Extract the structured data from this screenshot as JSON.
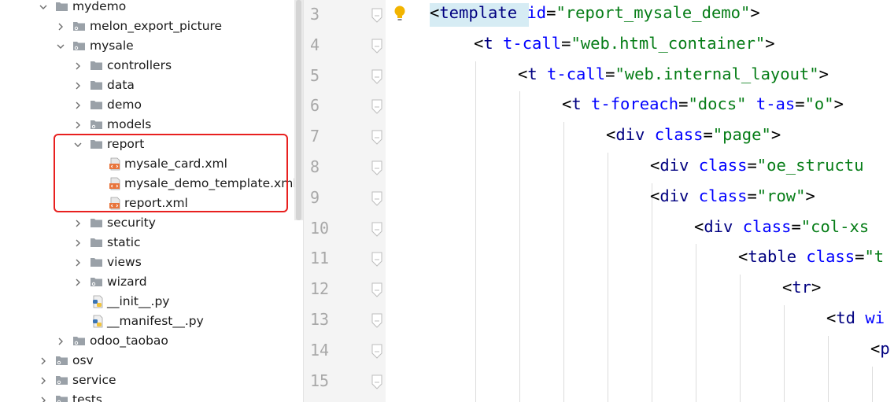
{
  "tree": {
    "items": [
      {
        "label": "mydemo",
        "kind": "folder",
        "expanded": true
      },
      {
        "label": "melon_export_picture",
        "kind": "module",
        "expanded": false
      },
      {
        "label": "mysale",
        "kind": "module",
        "expanded": true
      },
      {
        "label": "controllers",
        "kind": "folder",
        "expanded": false
      },
      {
        "label": "data",
        "kind": "folder",
        "expanded": false
      },
      {
        "label": "demo",
        "kind": "folder",
        "expanded": false
      },
      {
        "label": "models",
        "kind": "module",
        "expanded": false
      },
      {
        "label": "report",
        "kind": "folder",
        "expanded": true
      },
      {
        "label": "mysale_card.xml",
        "kind": "xml"
      },
      {
        "label": "mysale_demo_template.xml",
        "kind": "xml"
      },
      {
        "label": "report.xml",
        "kind": "xml"
      },
      {
        "label": "security",
        "kind": "folder",
        "expanded": false
      },
      {
        "label": "static",
        "kind": "folder",
        "expanded": false
      },
      {
        "label": "views",
        "kind": "folder",
        "expanded": false
      },
      {
        "label": "wizard",
        "kind": "module",
        "expanded": false
      },
      {
        "label": "__init__.py",
        "kind": "python"
      },
      {
        "label": "__manifest__.py",
        "kind": "python"
      },
      {
        "label": "odoo_taobao",
        "kind": "module",
        "expanded": false
      },
      {
        "label": "osv",
        "kind": "module",
        "expanded": false
      },
      {
        "label": "service",
        "kind": "module",
        "expanded": false
      },
      {
        "label": "tests",
        "kind": "module",
        "expanded": false
      }
    ]
  },
  "editor": {
    "line_numbers": [
      "3",
      "4",
      "5",
      "6",
      "7",
      "8",
      "9",
      "10",
      "11",
      "12",
      "13",
      "14",
      "15"
    ],
    "lines": [
      {
        "tokens": [
          [
            "punc",
            "<"
          ],
          [
            "tag",
            "template"
          ],
          [
            "punc",
            " "
          ],
          [
            "attr",
            "id"
          ],
          [
            "punc",
            "="
          ],
          [
            "str",
            "\"report_mysale_demo\""
          ],
          [
            "punc",
            ">"
          ]
        ]
      },
      {
        "tokens": [
          [
            "punc",
            "<"
          ],
          [
            "tag",
            "t"
          ],
          [
            "punc",
            " "
          ],
          [
            "attr",
            "t-call"
          ],
          [
            "punc",
            "="
          ],
          [
            "str",
            "\"web.html_container\""
          ],
          [
            "punc",
            ">"
          ]
        ]
      },
      {
        "tokens": [
          [
            "punc",
            "<"
          ],
          [
            "tag",
            "t"
          ],
          [
            "punc",
            " "
          ],
          [
            "attr",
            "t-call"
          ],
          [
            "punc",
            "="
          ],
          [
            "str",
            "\"web.internal_layout\""
          ],
          [
            "punc",
            ">"
          ]
        ]
      },
      {
        "tokens": [
          [
            "punc",
            "<"
          ],
          [
            "tag",
            "t"
          ],
          [
            "punc",
            " "
          ],
          [
            "attr",
            "t-foreach"
          ],
          [
            "punc",
            "="
          ],
          [
            "str",
            "\"docs\""
          ],
          [
            "punc",
            " "
          ],
          [
            "attr",
            "t-as"
          ],
          [
            "punc",
            "="
          ],
          [
            "str",
            "\"o\""
          ],
          [
            "punc",
            ">"
          ]
        ]
      },
      {
        "tokens": [
          [
            "punc",
            "<"
          ],
          [
            "tag",
            "div"
          ],
          [
            "punc",
            " "
          ],
          [
            "attr",
            "class"
          ],
          [
            "punc",
            "="
          ],
          [
            "str",
            "\"page\""
          ],
          [
            "punc",
            ">"
          ]
        ]
      },
      {
        "tokens": [
          [
            "punc",
            "<"
          ],
          [
            "tag",
            "div"
          ],
          [
            "punc",
            " "
          ],
          [
            "attr",
            "class"
          ],
          [
            "punc",
            "="
          ],
          [
            "str",
            "\"oe_structu"
          ]
        ]
      },
      {
        "tokens": [
          [
            "punc",
            "<"
          ],
          [
            "tag",
            "div"
          ],
          [
            "punc",
            " "
          ],
          [
            "attr",
            "class"
          ],
          [
            "punc",
            "="
          ],
          [
            "str",
            "\"row\""
          ],
          [
            "punc",
            ">"
          ]
        ]
      },
      {
        "tokens": [
          [
            "punc",
            "<"
          ],
          [
            "tag",
            "div"
          ],
          [
            "punc",
            " "
          ],
          [
            "attr",
            "class"
          ],
          [
            "punc",
            "="
          ],
          [
            "str",
            "\"col-xs"
          ]
        ]
      },
      {
        "tokens": [
          [
            "punc",
            "<"
          ],
          [
            "tag",
            "table"
          ],
          [
            "punc",
            " "
          ],
          [
            "attr",
            "class"
          ],
          [
            "punc",
            "="
          ],
          [
            "str",
            "\"t"
          ]
        ]
      },
      {
        "tokens": [
          [
            "punc",
            "<"
          ],
          [
            "tag",
            "tr"
          ],
          [
            "punc",
            ">"
          ]
        ]
      },
      {
        "tokens": [
          [
            "punc",
            "<"
          ],
          [
            "tag",
            "td"
          ],
          [
            "punc",
            " "
          ],
          [
            "attr",
            "wi"
          ]
        ]
      },
      {
        "tokens": [
          [
            "punc",
            "<"
          ],
          [
            "tag",
            "p"
          ]
        ]
      },
      {
        "tokens": []
      }
    ]
  },
  "colors": {
    "highlight_box": "#e8201f",
    "tag": "#000080",
    "attr": "#0000ff",
    "string": "#067d17"
  }
}
